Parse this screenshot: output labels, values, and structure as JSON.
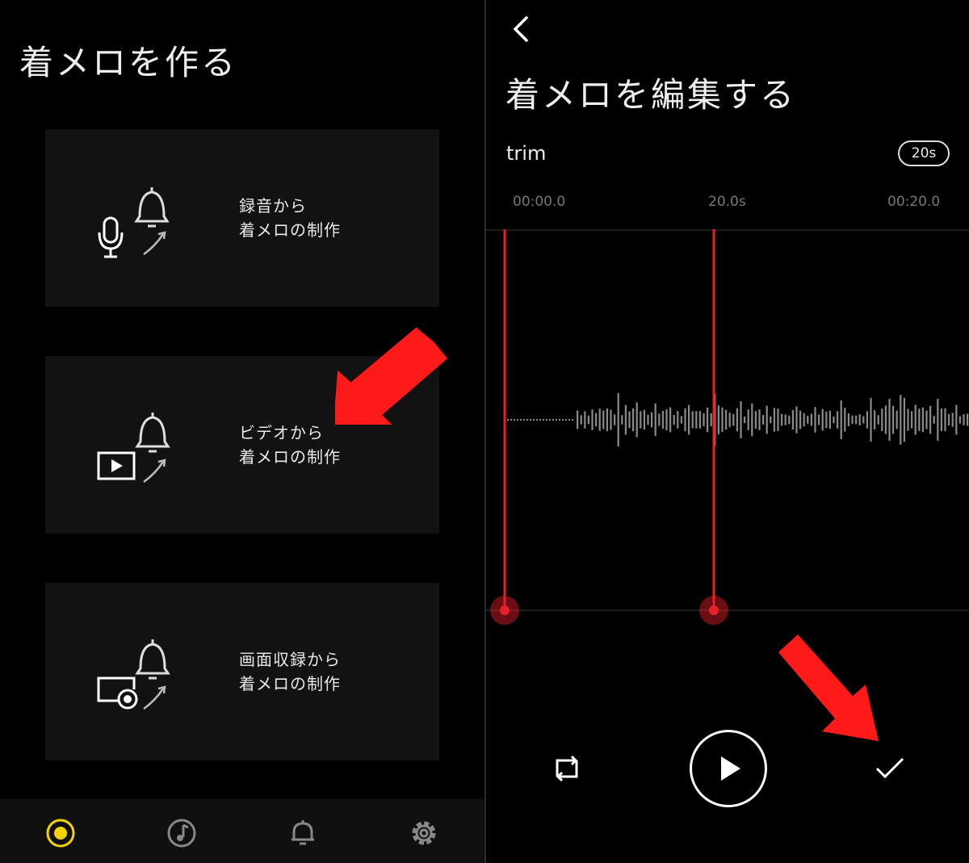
{
  "left": {
    "title": "着メロを作る",
    "cards": [
      {
        "line1": "録音から",
        "line2": "着メロの制作",
        "icon": "microphone-bell-icon"
      },
      {
        "line1": "ビデオから",
        "line2": "着メロの制作",
        "icon": "video-bell-icon"
      },
      {
        "line1": "画面収録から",
        "line2": "着メロの制作",
        "icon": "screen-record-bell-icon"
      }
    ],
    "tabs": [
      {
        "icon": "record-icon",
        "active": true
      },
      {
        "icon": "music-note-icon",
        "active": false
      },
      {
        "icon": "bell-icon",
        "active": false
      },
      {
        "icon": "gear-icon",
        "active": false
      }
    ]
  },
  "right": {
    "title": "着メロを編集する",
    "trim_label": "trim",
    "duration_badge": "20s",
    "timeline": {
      "start": "00:00.0",
      "middle": "20.0s",
      "end": "00:20.0"
    },
    "controls": [
      "loop-icon",
      "play-icon",
      "check-icon"
    ]
  },
  "colors": {
    "background": "#000000",
    "card": "#121212",
    "accent_yellow": "#f5d300",
    "trim_red": "#e8202a",
    "annotation_arrow": "#ff1a1a",
    "waveform": "#888888"
  }
}
